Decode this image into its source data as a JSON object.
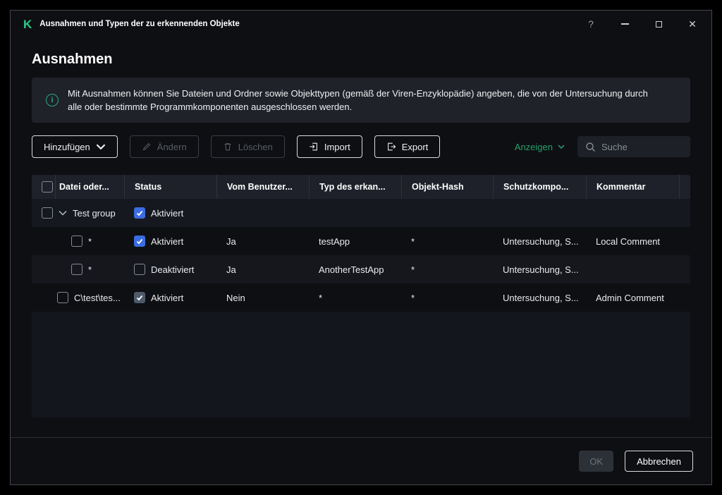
{
  "window": {
    "title": "Ausnahmen und Typen der zu erkennenden Objekte",
    "logo_letter": "K",
    "controls": {
      "help": "?",
      "close": "✕"
    }
  },
  "page": {
    "title": "Ausnahmen",
    "info_text": "Mit Ausnahmen können Sie Dateien und Ordner sowie Objekttypen (gemäß der Viren-Enzyklopädie) angeben, die von der Untersuchung durch alle oder bestimmte Programmkomponenten ausgeschlossen werden."
  },
  "toolbar": {
    "add": "Hinzufügen",
    "edit": "Ändern",
    "delete": "Löschen",
    "import": "Import",
    "export": "Export",
    "show": "Anzeigen",
    "search_placeholder": "Suche"
  },
  "table": {
    "columns": {
      "file": "Datei oder...",
      "status": "Status",
      "user": "Vom Benutzer...",
      "type": "Typ des erkan...",
      "hash": "Objekt-Hash",
      "components": "Schutzkompo...",
      "comment": "Kommentar"
    },
    "select_all_checked": false,
    "group": {
      "name": "Test group",
      "status": "Aktiviert",
      "checked": true,
      "selected": false
    },
    "rows": [
      {
        "file": "*",
        "status": "Aktiviert",
        "checked": true,
        "locked": false,
        "user": "Ja",
        "type": "testApp",
        "hash": "*",
        "components": "Untersuchung, S...",
        "comment": "Local Comment",
        "selected": false
      },
      {
        "file": "*",
        "status": "Deaktiviert",
        "checked": false,
        "locked": false,
        "user": "Ja",
        "type": "AnotherTestApp",
        "hash": "*",
        "components": "Untersuchung, S...",
        "comment": "",
        "selected": false
      },
      {
        "file": "C\\test\\tes...",
        "status": "Aktiviert",
        "checked": true,
        "locked": true,
        "user": "Nein",
        "type": "*",
        "hash": "*",
        "components": "Untersuchung, S...",
        "comment": "Admin Comment",
        "selected": false
      }
    ]
  },
  "footer": {
    "ok": "OK",
    "cancel": "Abbrechen"
  },
  "colors": {
    "accent_green": "#2ec98c",
    "link_green": "#27a06a",
    "checkbox_blue": "#3c6ce1",
    "checkbox_locked": "#4e5a6b"
  }
}
